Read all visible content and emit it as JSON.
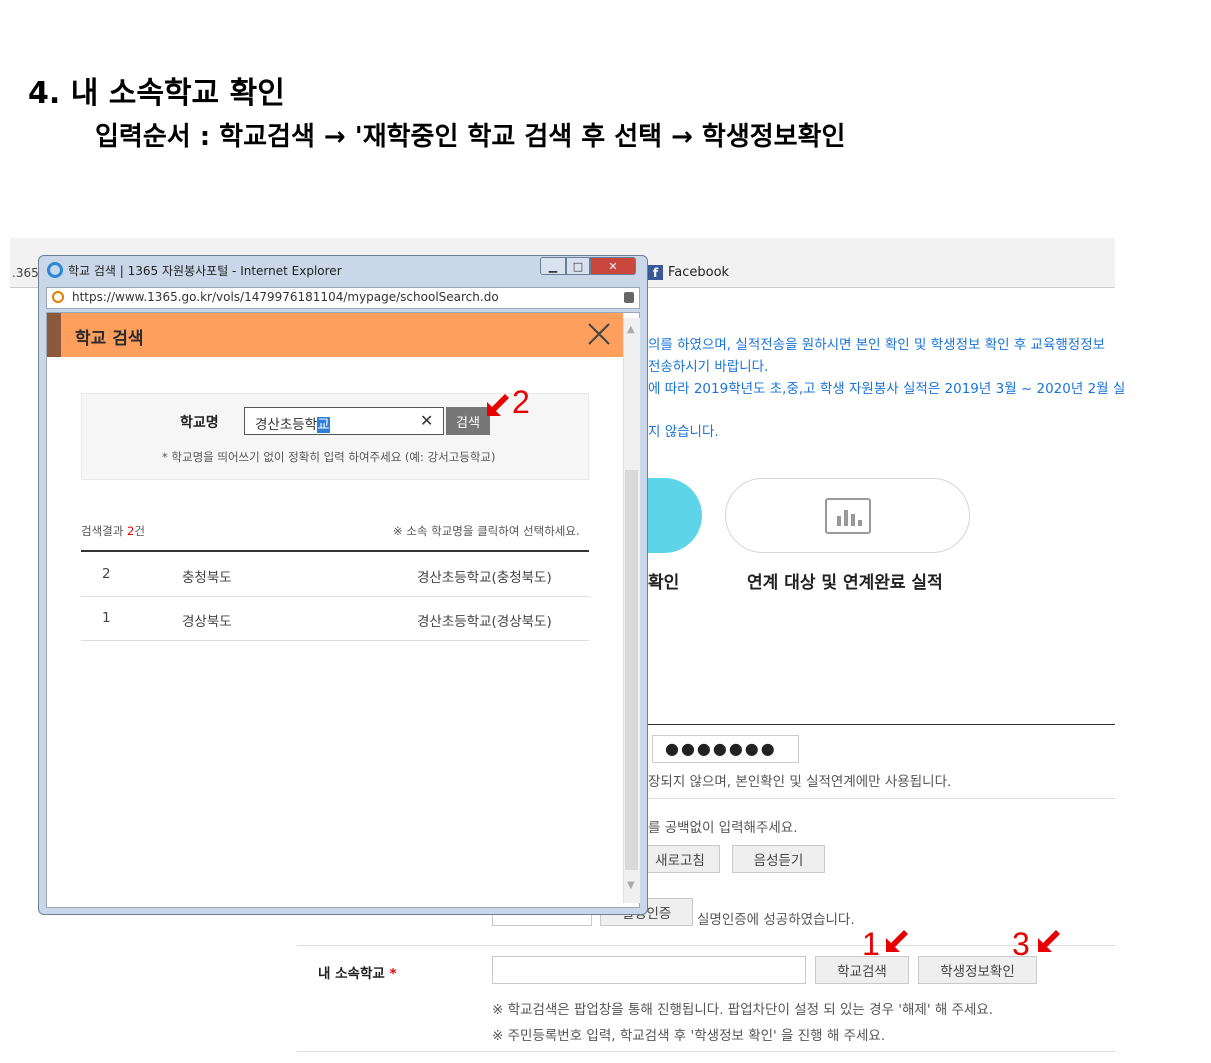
{
  "heading": {
    "title": "4. 내 소속학교 확인",
    "subtitle": "입력순서 : 학교검색 → '재학중인 학교 검색 후 선택 → 학생정보확인"
  },
  "background_page": {
    "left_edge_text": ".365",
    "facebook_label": "Facebook",
    "notices": [
      "의를 하였으며, 실적전송을 원하시면 본인 확인 및 학생정보 확인 후 교육행정정보",
      "전송하시기 바랍니다.",
      "에 따라 2019학년도 초,중,고 학생 자원봉사 실적은 2019년 3월 ~ 2020년 2월 실",
      "지 않습니다."
    ],
    "menu_left_label": "확인",
    "menu_right_label": "연계 대상 및 연계완료 실적",
    "masked_value": "●●●●●●●",
    "note_storage": "장되지 않으며, 본인확인 및 실적연계에만 사용됩니다.",
    "note_input": "를 공백없이 입력해주세요.",
    "refresh_button": "새로고침",
    "audio_button": "음성듣기",
    "verify_button": "실명인증",
    "verify_result": "실명인증에 성공하였습니다.",
    "school_label": "내 소속학교",
    "required_mark": "*",
    "school_search_button": "학교검색",
    "student_info_button": "학생정보확인",
    "footnote_1": "※ 학교검색은 팝업창을 통해 진행됩니다. 팝업차단이 설정 되 있는 경우 '해제' 해 주세요.",
    "footnote_2": "※ 주민등록번호 입력, 학교검색 후 '학생정보 확인' 을 진행 해 주세요."
  },
  "popup": {
    "window_title": "학교 검색 | 1365 자원봉사포털 - Internet Explorer",
    "address": "https://www.1365.go.kr/vols/1479976181104/mypage/schoolSearch.do",
    "header": "학교 검색",
    "school_name_label": "학교명",
    "search_value_prefix": "경산초등학",
    "search_value_selected": "교",
    "clear_glyph": "✕",
    "search_button": "검색",
    "hint": "* 학교명을 띄어쓰기 없이 정확히 입력 하여주세요 (예: 강서고등학교)",
    "result_prefix": "검색결과 ",
    "result_count": "2",
    "result_suffix": "건",
    "result_hint": "※ 소속 학교명을 클릭하여 선택하세요.",
    "results": [
      {
        "no": "2",
        "region": "충청북도",
        "school": "경산초등학교(충청북도)"
      },
      {
        "no": "1",
        "region": "경상북도",
        "school": "경산초등학교(경상북도)"
      }
    ]
  },
  "annotations": {
    "marker_1": "1",
    "marker_2": "2",
    "marker_3": "3",
    "arrow_color": "#e60000"
  }
}
